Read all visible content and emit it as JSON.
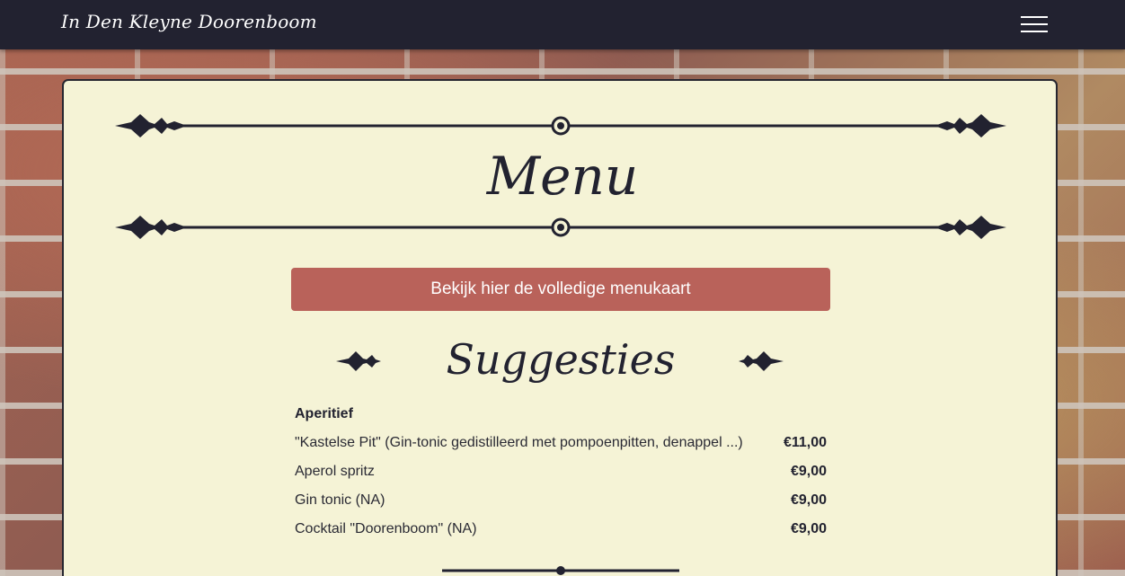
{
  "navbar": {
    "brand": "In Den Kleyne Doorenboom",
    "menu_icon": "hamburger-menu-icon"
  },
  "page": {
    "title": "Menu",
    "full_menu_button": "Bekijk hier de volledige menukaart",
    "suggestions_title": "Suggesties",
    "ornament_icon": "diamond-ornament-icon"
  },
  "suggestions": {
    "category": "Aperitief",
    "items": [
      {
        "name": "\"Kastelse Pit\" (Gin-tonic gedistilleerd met pompoenpitten, denappel ...)",
        "price": "€11,00"
      },
      {
        "name": "Aperol spritz",
        "price": "€9,00"
      },
      {
        "name": "Gin tonic (NA)",
        "price": "€9,00"
      },
      {
        "name": "Cocktail \"Doorenboom\" (NA)",
        "price": "€9,00"
      }
    ]
  },
  "colors": {
    "navbar": "#222230",
    "card_background": "#f5f3d6",
    "button": "#b9625a",
    "ink": "#222230"
  }
}
